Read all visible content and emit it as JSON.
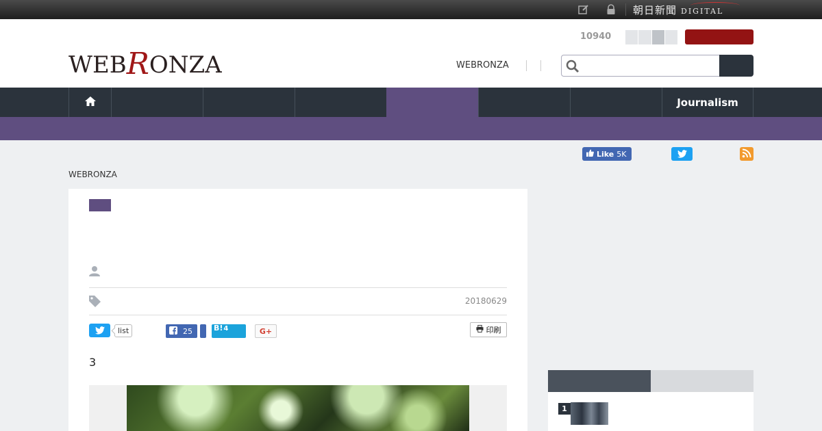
{
  "topbar": {
    "icons": [
      "edit-icon",
      "lock-icon"
    ],
    "brand_jp": "朝日新聞",
    "brand_en": "DIGITAL"
  },
  "header": {
    "logo_part1": "WEB",
    "logo_part2": "R",
    "logo_part3": "ONZA",
    "counter": "10940",
    "nav_link": "WEBRONZA",
    "search": {
      "placeholder": ""
    }
  },
  "navbar": {
    "home_icon": "home-icon",
    "last_item": "Journalism",
    "accent_color": "#5f4e80"
  },
  "social_top": {
    "fb_like_label": "Like",
    "fb_like_count": "5K"
  },
  "breadcrumb": "WEBRONZA",
  "article": {
    "date": "20180629",
    "share": {
      "list_label": "list",
      "fb_count": "25",
      "hatena_label": "B!",
      "hatena_count": "4",
      "gplus_label": "G+",
      "print_label": "印刷"
    },
    "body_text": "3"
  },
  "ranking": {
    "items": [
      {
        "rank": "1"
      }
    ]
  }
}
